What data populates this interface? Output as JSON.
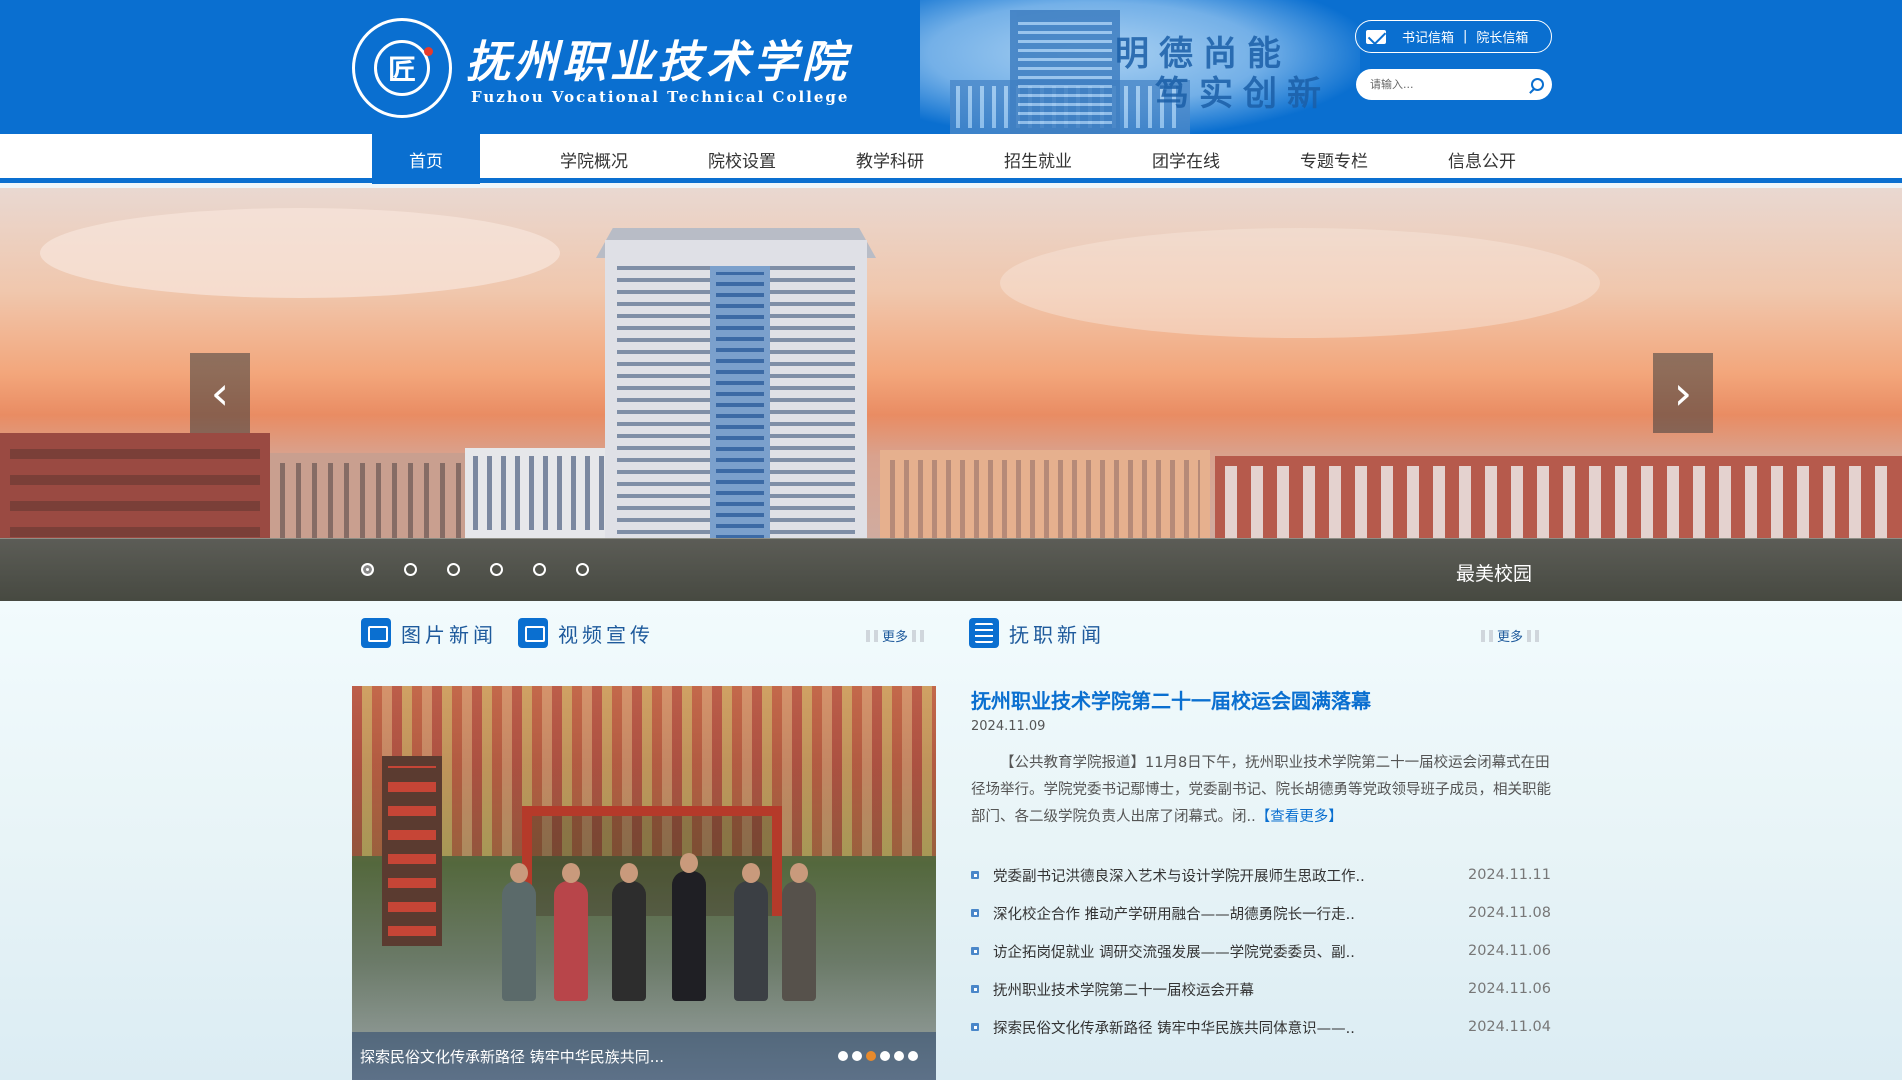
{
  "header": {
    "logo_text": "匠",
    "school_name_cn": "抚州职业技术学院",
    "school_name_en": "Fuzhou Vocational Technical College",
    "motto_line1": "明德尚能",
    "motto_line2": "笃实创新",
    "mailbox": {
      "secretary": "书记信箱",
      "separator": "|",
      "president": "院长信箱"
    },
    "search": {
      "placeholder": "请输入..."
    }
  },
  "nav": {
    "items": [
      "首页",
      "学院概况",
      "院校设置",
      "教学科研",
      "招生就业",
      "团学在线",
      "专题专栏",
      "信息公开"
    ],
    "active_index": 0
  },
  "banner": {
    "caption": "最美校园",
    "slide_count": 6,
    "active_slide": 0,
    "prev_glyph": "‹",
    "next_glyph": "›"
  },
  "left_section": {
    "tab1": "图片新闻",
    "tab2": "视频宣传",
    "more": "更多",
    "photo_caption": "探索民俗文化传承新路径 铸牢中华民族共同...",
    "photo_dot_count": 6,
    "photo_active_dot": 2
  },
  "right_section": {
    "title": "抚职新闻",
    "more": "更多",
    "headline": "抚州职业技术学院第二十一届校运会圆满落幕",
    "headline_date": "2024.11.09",
    "summary": "【公共教育学院报道】11月8日下午，抚州职业技术学院第二十一届校运会闭幕式在田径场举行。学院党委书记鄢博士，党委副书记、院长胡德勇等党政领导班子成员，相关职能部门、各二级学院负责人出席了闭幕式。闭..",
    "read_more": "【查看更多】",
    "news": [
      {
        "title": "党委副书记洪德良深入艺术与设计学院开展师生思政工作..",
        "date": "2024.11.11"
      },
      {
        "title": "深化校企合作 推动产学研用融合——胡德勇院长一行走..",
        "date": "2024.11.08"
      },
      {
        "title": "访企拓岗促就业 调研交流强发展——学院党委委员、副..",
        "date": "2024.11.06"
      },
      {
        "title": "抚州职业技术学院第二十一届校运会开幕",
        "date": "2024.11.06"
      },
      {
        "title": "探索民俗文化传承新路径 铸牢中华民族共同体意识——..",
        "date": "2024.11.04"
      }
    ]
  },
  "colors": {
    "brand_blue": "#0a6fd0",
    "title_blue": "#1e5a9c",
    "active_dot_orange": "#e88a2c"
  }
}
